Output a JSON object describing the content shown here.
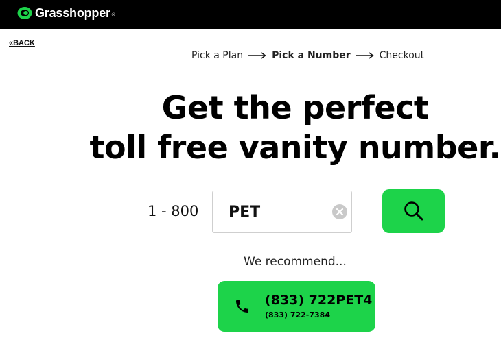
{
  "header": {
    "logo_text": "Grasshopper",
    "logo_mark": "grasshopper-logo-icon",
    "trademark": "®"
  },
  "nav": {
    "back_label": "«BACK"
  },
  "steps": {
    "step1": "Pick a Plan",
    "step2": "Pick a Number",
    "step3": "Checkout",
    "arrow_icon": "long-arrow-right-icon"
  },
  "hero": {
    "line1": "Get the perfect",
    "line2": "toll free vanity number."
  },
  "search": {
    "prefix": "1 - 800",
    "query": "PET",
    "clear_icon": "clear-x-icon",
    "search_icon": "search-icon"
  },
  "recommend": {
    "label": "We recommend...",
    "vanity_number": "(833) 722PET4",
    "numeric_number": "(833) 722-7384",
    "phone_icon": "phone-icon"
  },
  "colors": {
    "brand_green": "#1dd34a",
    "header_bg": "#000000"
  }
}
